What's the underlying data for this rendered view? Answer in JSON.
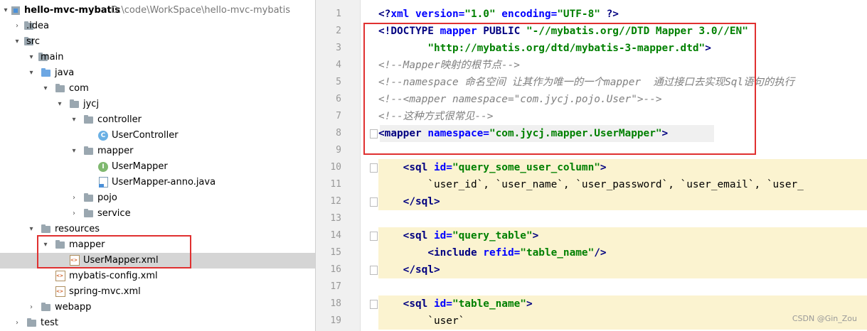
{
  "project_tree": {
    "root": {
      "label": "hello-mvc-mybatis",
      "path": "D:\\code\\WorkSpace\\hello-mvc-mybatis"
    },
    "items": [
      {
        "label": ".idea"
      },
      {
        "label": "src"
      },
      {
        "label": "main"
      },
      {
        "label": "java"
      },
      {
        "label": "com"
      },
      {
        "label": "jycj"
      },
      {
        "label": "controller"
      },
      {
        "label": "UserController"
      },
      {
        "label": "mapper"
      },
      {
        "label": "UserMapper"
      },
      {
        "label": "UserMapper-anno.java"
      },
      {
        "label": "pojo"
      },
      {
        "label": "service"
      },
      {
        "label": "resources"
      },
      {
        "label": "mapper"
      },
      {
        "label": "UserMapper.xml"
      },
      {
        "label": "mybatis-config.xml"
      },
      {
        "label": "spring-mvc.xml"
      },
      {
        "label": "webapp"
      },
      {
        "label": "test"
      }
    ],
    "icons": {
      "class": "C",
      "interface": "I"
    }
  },
  "editor": {
    "line_numbers": [
      "1",
      "2",
      "3",
      "4",
      "5",
      "6",
      "7",
      "8",
      "9",
      "10",
      "11",
      "12",
      "13",
      "14",
      "15",
      "16",
      "17",
      "18",
      "19"
    ],
    "lines": [
      [
        [
          "<?",
          "q"
        ],
        [
          "xml ",
          "an"
        ],
        [
          "version=",
          "an"
        ],
        [
          "\"1.0\"",
          "av"
        ],
        [
          " encoding=",
          "an"
        ],
        [
          "\"UTF-8\"",
          "av"
        ],
        [
          " ?>",
          "q"
        ]
      ],
      [
        [
          "<!DOCTYPE ",
          "kw"
        ],
        [
          "mapper ",
          "an"
        ],
        [
          "PUBLIC ",
          "kw"
        ],
        [
          "\"-//mybatis.org//DTD Mapper 3.0//EN\"",
          "av"
        ]
      ],
      [
        [
          "        ",
          ""
        ],
        [
          "\"http://mybatis.org/dtd/mybatis-3-mapper.dtd\"",
          "av"
        ],
        [
          ">",
          "kw"
        ]
      ],
      [
        [
          "<!--Mapper映射的根节点-->",
          "cm"
        ]
      ],
      [
        [
          "<!--namespace 命名空间 让其作为唯一的一个mapper  通过接口去实现Sql语句的执行",
          "cm"
        ]
      ],
      [
        [
          "<!--<mapper namespace=\"com.jycj.pojo.User\">-->",
          "cm"
        ]
      ],
      [
        [
          "<!--这种方式很常见-->",
          "cm"
        ]
      ],
      [
        [
          "<mapper ",
          "kw"
        ],
        [
          "namespace=",
          "an"
        ],
        [
          "\"com.jycj.mapper.UserMapper\"",
          "av"
        ],
        [
          ">",
          "kw"
        ]
      ],
      [
        [
          "",
          ""
        ]
      ],
      [
        [
          "    ",
          ""
        ],
        [
          "<sql ",
          "kw"
        ],
        [
          "id=",
          "an"
        ],
        [
          "\"query_some_user_column\"",
          "av"
        ],
        [
          ">",
          "kw"
        ]
      ],
      [
        [
          "        `user_id`, `user_name`, `user_password`, `user_email`, `user_",
          ""
        ]
      ],
      [
        [
          "    ",
          ""
        ],
        [
          "</sql>",
          "kw"
        ]
      ],
      [
        [
          "",
          ""
        ]
      ],
      [
        [
          "    ",
          ""
        ],
        [
          "<sql ",
          "kw"
        ],
        [
          "id=",
          "an"
        ],
        [
          "\"query_table\"",
          "av"
        ],
        [
          ">",
          "kw"
        ]
      ],
      [
        [
          "        ",
          ""
        ],
        [
          "<include ",
          "kw"
        ],
        [
          "refid=",
          "an"
        ],
        [
          "\"table_name\"",
          "av"
        ],
        [
          "/>",
          "kw"
        ]
      ],
      [
        [
          "    ",
          ""
        ],
        [
          "</sql>",
          "kw"
        ]
      ],
      [
        [
          "",
          ""
        ]
      ],
      [
        [
          "    ",
          ""
        ],
        [
          "<sql ",
          "kw"
        ],
        [
          "id=",
          "an"
        ],
        [
          "\"table_name\"",
          "av"
        ],
        [
          ">",
          "kw"
        ]
      ],
      [
        [
          "        `user`",
          ""
        ]
      ]
    ]
  },
  "watermark": "CSDN @Gin_Zou",
  "colors": {
    "highlight": "#fbf3d0",
    "annotation_box": "#e03030",
    "selection": "#d5d5d5"
  }
}
